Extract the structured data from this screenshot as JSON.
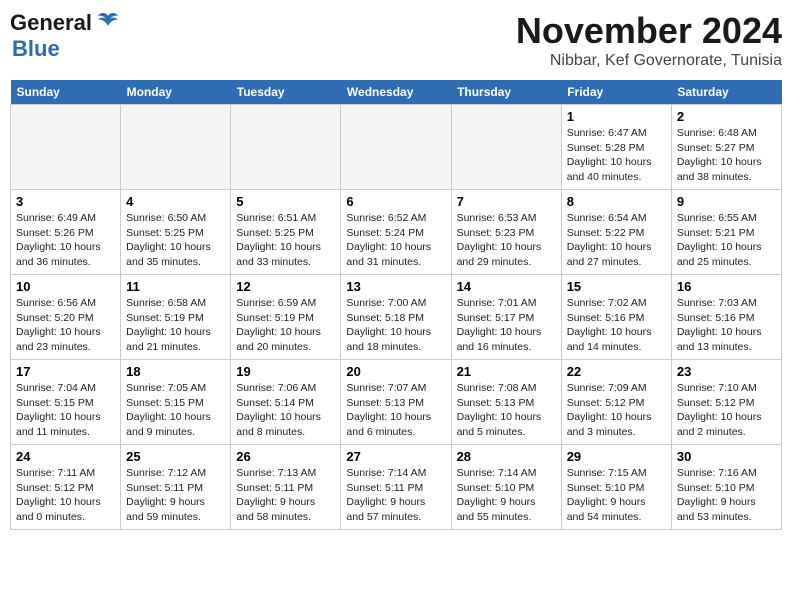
{
  "header": {
    "logo_general": "General",
    "logo_blue": "Blue",
    "month_year": "November 2024",
    "location": "Nibbar, Kef Governorate, Tunisia"
  },
  "days_of_week": [
    "Sunday",
    "Monday",
    "Tuesday",
    "Wednesday",
    "Thursday",
    "Friday",
    "Saturday"
  ],
  "weeks": [
    [
      {
        "day": "",
        "info": ""
      },
      {
        "day": "",
        "info": ""
      },
      {
        "day": "",
        "info": ""
      },
      {
        "day": "",
        "info": ""
      },
      {
        "day": "",
        "info": ""
      },
      {
        "day": "1",
        "info": "Sunrise: 6:47 AM\nSunset: 5:28 PM\nDaylight: 10 hours and 40 minutes."
      },
      {
        "day": "2",
        "info": "Sunrise: 6:48 AM\nSunset: 5:27 PM\nDaylight: 10 hours and 38 minutes."
      }
    ],
    [
      {
        "day": "3",
        "info": "Sunrise: 6:49 AM\nSunset: 5:26 PM\nDaylight: 10 hours and 36 minutes."
      },
      {
        "day": "4",
        "info": "Sunrise: 6:50 AM\nSunset: 5:25 PM\nDaylight: 10 hours and 35 minutes."
      },
      {
        "day": "5",
        "info": "Sunrise: 6:51 AM\nSunset: 5:25 PM\nDaylight: 10 hours and 33 minutes."
      },
      {
        "day": "6",
        "info": "Sunrise: 6:52 AM\nSunset: 5:24 PM\nDaylight: 10 hours and 31 minutes."
      },
      {
        "day": "7",
        "info": "Sunrise: 6:53 AM\nSunset: 5:23 PM\nDaylight: 10 hours and 29 minutes."
      },
      {
        "day": "8",
        "info": "Sunrise: 6:54 AM\nSunset: 5:22 PM\nDaylight: 10 hours and 27 minutes."
      },
      {
        "day": "9",
        "info": "Sunrise: 6:55 AM\nSunset: 5:21 PM\nDaylight: 10 hours and 25 minutes."
      }
    ],
    [
      {
        "day": "10",
        "info": "Sunrise: 6:56 AM\nSunset: 5:20 PM\nDaylight: 10 hours and 23 minutes."
      },
      {
        "day": "11",
        "info": "Sunrise: 6:58 AM\nSunset: 5:19 PM\nDaylight: 10 hours and 21 minutes."
      },
      {
        "day": "12",
        "info": "Sunrise: 6:59 AM\nSunset: 5:19 PM\nDaylight: 10 hours and 20 minutes."
      },
      {
        "day": "13",
        "info": "Sunrise: 7:00 AM\nSunset: 5:18 PM\nDaylight: 10 hours and 18 minutes."
      },
      {
        "day": "14",
        "info": "Sunrise: 7:01 AM\nSunset: 5:17 PM\nDaylight: 10 hours and 16 minutes."
      },
      {
        "day": "15",
        "info": "Sunrise: 7:02 AM\nSunset: 5:16 PM\nDaylight: 10 hours and 14 minutes."
      },
      {
        "day": "16",
        "info": "Sunrise: 7:03 AM\nSunset: 5:16 PM\nDaylight: 10 hours and 13 minutes."
      }
    ],
    [
      {
        "day": "17",
        "info": "Sunrise: 7:04 AM\nSunset: 5:15 PM\nDaylight: 10 hours and 11 minutes."
      },
      {
        "day": "18",
        "info": "Sunrise: 7:05 AM\nSunset: 5:15 PM\nDaylight: 10 hours and 9 minutes."
      },
      {
        "day": "19",
        "info": "Sunrise: 7:06 AM\nSunset: 5:14 PM\nDaylight: 10 hours and 8 minutes."
      },
      {
        "day": "20",
        "info": "Sunrise: 7:07 AM\nSunset: 5:13 PM\nDaylight: 10 hours and 6 minutes."
      },
      {
        "day": "21",
        "info": "Sunrise: 7:08 AM\nSunset: 5:13 PM\nDaylight: 10 hours and 5 minutes."
      },
      {
        "day": "22",
        "info": "Sunrise: 7:09 AM\nSunset: 5:12 PM\nDaylight: 10 hours and 3 minutes."
      },
      {
        "day": "23",
        "info": "Sunrise: 7:10 AM\nSunset: 5:12 PM\nDaylight: 10 hours and 2 minutes."
      }
    ],
    [
      {
        "day": "24",
        "info": "Sunrise: 7:11 AM\nSunset: 5:12 PM\nDaylight: 10 hours and 0 minutes."
      },
      {
        "day": "25",
        "info": "Sunrise: 7:12 AM\nSunset: 5:11 PM\nDaylight: 9 hours and 59 minutes."
      },
      {
        "day": "26",
        "info": "Sunrise: 7:13 AM\nSunset: 5:11 PM\nDaylight: 9 hours and 58 minutes."
      },
      {
        "day": "27",
        "info": "Sunrise: 7:14 AM\nSunset: 5:11 PM\nDaylight: 9 hours and 57 minutes."
      },
      {
        "day": "28",
        "info": "Sunrise: 7:14 AM\nSunset: 5:10 PM\nDaylight: 9 hours and 55 minutes."
      },
      {
        "day": "29",
        "info": "Sunrise: 7:15 AM\nSunset: 5:10 PM\nDaylight: 9 hours and 54 minutes."
      },
      {
        "day": "30",
        "info": "Sunrise: 7:16 AM\nSunset: 5:10 PM\nDaylight: 9 hours and 53 minutes."
      }
    ]
  ]
}
